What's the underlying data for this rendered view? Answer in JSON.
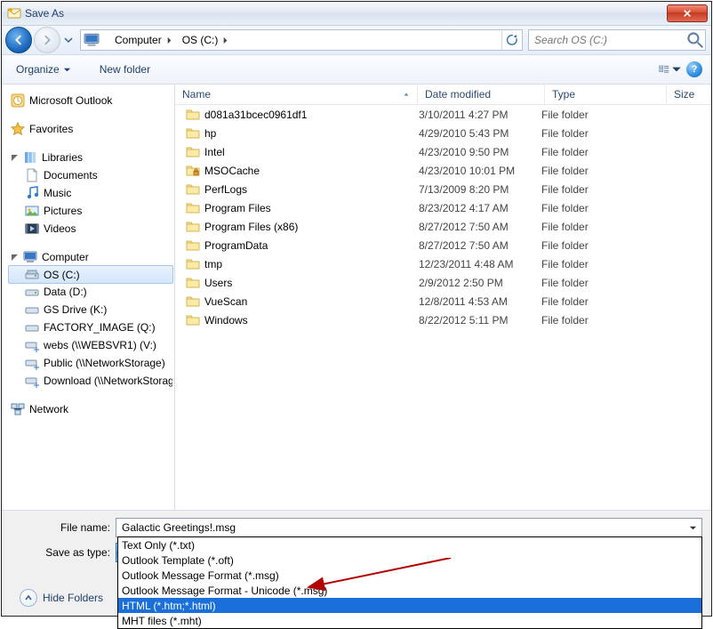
{
  "title": "Save As",
  "breadcrumb": {
    "items": [
      "Computer",
      "OS (C:)"
    ]
  },
  "search_placeholder": "Search OS (C:)",
  "toolbar": {
    "organize": "Organize",
    "newfolder": "New folder"
  },
  "tree": {
    "outlook": "Microsoft Outlook",
    "favorites": "Favorites",
    "libraries": "Libraries",
    "documents": "Documents",
    "music": "Music",
    "pictures": "Pictures",
    "videos": "Videos",
    "computer": "Computer",
    "osc": "OS (C:)",
    "data_d": "Data (D:)",
    "gs_k": "GS Drive (K:)",
    "factory_q": "FACTORY_IMAGE (Q:)",
    "webs_v": "webs (\\\\WEBSVR1) (V:)",
    "public_w": "Public (\\\\NetworkStorage)",
    "download_x": "Download (\\\\NetworkStorage)",
    "network": "Network"
  },
  "columns": {
    "name": "Name",
    "date": "Date modified",
    "type": "Type",
    "size": "Size"
  },
  "rows": [
    {
      "name": "d081a31bcec0961df1",
      "date": "3/10/2011 4:27 PM",
      "type": "File folder",
      "locked": false
    },
    {
      "name": "hp",
      "date": "4/29/2010 5:43 PM",
      "type": "File folder",
      "locked": false
    },
    {
      "name": "Intel",
      "date": "4/23/2010 9:50 PM",
      "type": "File folder",
      "locked": false
    },
    {
      "name": "MSOCache",
      "date": "4/23/2010 10:01 PM",
      "type": "File folder",
      "locked": true
    },
    {
      "name": "PerfLogs",
      "date": "7/13/2009 8:20 PM",
      "type": "File folder",
      "locked": false
    },
    {
      "name": "Program Files",
      "date": "8/23/2012 4:17 AM",
      "type": "File folder",
      "locked": false
    },
    {
      "name": "Program Files (x86)",
      "date": "8/27/2012 7:50 AM",
      "type": "File folder",
      "locked": false
    },
    {
      "name": "ProgramData",
      "date": "8/27/2012 7:50 AM",
      "type": "File folder",
      "locked": false
    },
    {
      "name": "tmp",
      "date": "12/23/2011 4:48 AM",
      "type": "File folder",
      "locked": false
    },
    {
      "name": "Users",
      "date": "2/9/2012 2:50 PM",
      "type": "File folder",
      "locked": false
    },
    {
      "name": "VueScan",
      "date": "12/8/2011 4:53 AM",
      "type": "File folder",
      "locked": false
    },
    {
      "name": "Windows",
      "date": "8/22/2012 5:11 PM",
      "type": "File folder",
      "locked": false
    }
  ],
  "filename_label": "File name:",
  "filename_value": "Galactic Greetings!.msg",
  "savetype_label": "Save as type:",
  "savetype_value": "Outlook Message Format - Unicode (*.msg)",
  "options": [
    "Text Only (*.txt)",
    "Outlook Template (*.oft)",
    "Outlook Message Format (*.msg)",
    "Outlook Message Format - Unicode (*.msg)",
    "HTML (*.htm;*.html)",
    "MHT files (*.mht)"
  ],
  "selected_option_index": 4,
  "hide_folders": "Hide Folders"
}
